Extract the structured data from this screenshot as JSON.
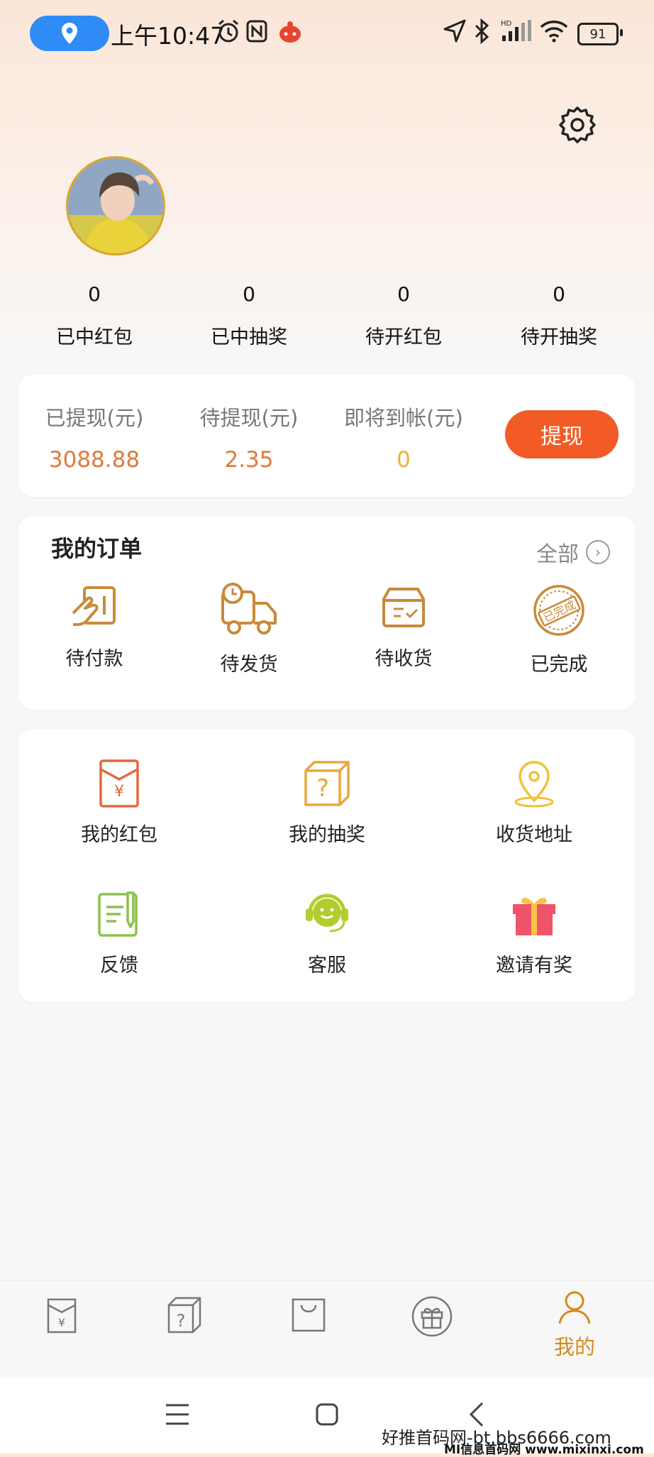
{
  "status_bar": {
    "time": "上午10:47",
    "battery": "91"
  },
  "stats": [
    {
      "value": "0",
      "label": "已中红包"
    },
    {
      "value": "0",
      "label": "已中抽奖"
    },
    {
      "value": "0",
      "label": "待开红包"
    },
    {
      "value": "0",
      "label": "待开抽奖"
    }
  ],
  "wallet": {
    "withdrawn_label": "已提现(元)",
    "withdrawn_value": "3088.88",
    "pending_label": "待提现(元)",
    "pending_value": "2.35",
    "arriving_label": "即将到帐(元)",
    "arriving_value": "0",
    "withdraw_button": "提现"
  },
  "orders": {
    "title": "我的订单",
    "all_label": "全部",
    "items": [
      {
        "label": "待付款",
        "icon": "card-icon"
      },
      {
        "label": "待发货",
        "icon": "truck-icon"
      },
      {
        "label": "待收货",
        "icon": "box-icon"
      },
      {
        "label": "已完成",
        "icon": "stamp-icon",
        "stamp_text": "已完成"
      }
    ]
  },
  "services": [
    {
      "label": "我的红包",
      "icon": "red-envelope-icon"
    },
    {
      "label": "我的抽奖",
      "icon": "lottery-box-icon"
    },
    {
      "label": "收货地址",
      "icon": "location-icon"
    },
    {
      "label": "反馈",
      "icon": "feedback-icon"
    },
    {
      "label": "客服",
      "icon": "headset-icon"
    },
    {
      "label": "邀请有奖",
      "icon": "gift-icon"
    }
  ],
  "tabbar": {
    "items": [
      {
        "icon": "envelope-tab-icon"
      },
      {
        "icon": "box-tab-icon"
      },
      {
        "icon": "bag-tab-icon"
      },
      {
        "icon": "gift-tab-icon"
      },
      {
        "icon": "user-tab-icon",
        "label": "我的",
        "active": true
      }
    ]
  },
  "colors": {
    "accent": "#f25b26",
    "amount": "#e07a3c",
    "tab_active": "#d68a1a",
    "order_icon": "#c98a3a"
  },
  "watermark": {
    "line1": "好推首码网-bt.bbs6666.com",
    "line2": "MI信息首码网 www.mixinxi.com"
  }
}
